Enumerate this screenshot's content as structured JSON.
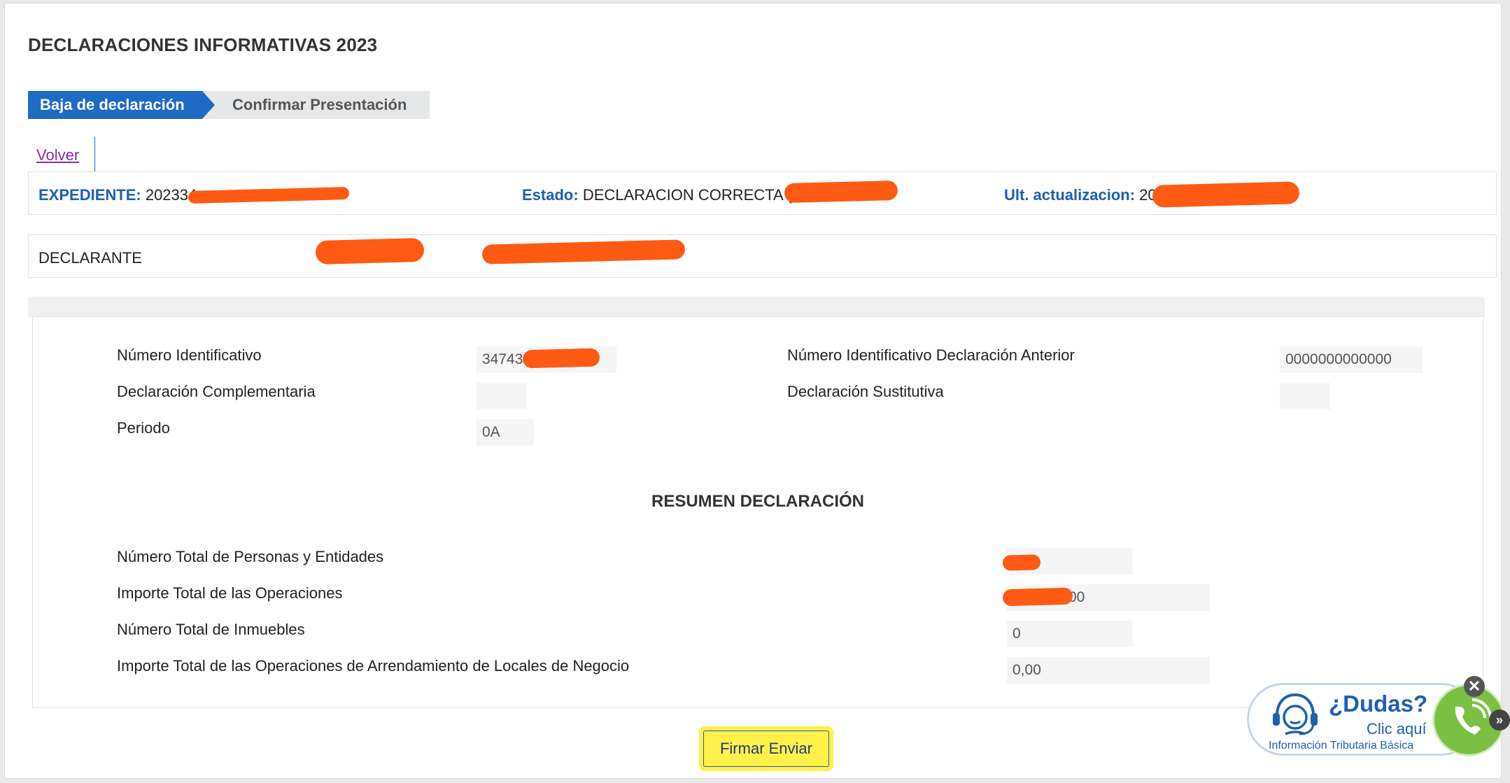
{
  "page": {
    "title": "DECLARACIONES INFORMATIVAS 2023"
  },
  "steps": [
    {
      "label": "Baja de declaración",
      "active": true
    },
    {
      "label": "Confirmar Presentación",
      "active": false
    }
  ],
  "nav": {
    "back_label": "Volver"
  },
  "expediente": {
    "expediente_label": "EXPEDIENTE:",
    "expediente_value": "202334",
    "estado_label": "Estado:",
    "estado_value": "DECLARACION CORRECTA (",
    "ult_label": "Ult. actualizacion:",
    "ult_value": "20"
  },
  "declarante": {
    "label": "DECLARANTE"
  },
  "details": {
    "numero_identificativo_label": "Número Identificativo",
    "numero_identificativo_value": "34743",
    "numero_anterior_label": "Número Identificativo Declaración Anterior",
    "numero_anterior_value": "0000000000000",
    "complementaria_label": "Declaración Complementaria",
    "complementaria_value": "",
    "sustitutiva_label": "Declaración Sustitutiva",
    "sustitutiva_value": "",
    "periodo_label": "Periodo",
    "periodo_value": "0A"
  },
  "resumen": {
    "title": "RESUMEN DECLARACIÓN",
    "personas_label": "Número Total de Personas y Entidades",
    "personas_value": "",
    "importe_label": "Importe Total de las Operaciones",
    "importe_value": "00",
    "inmuebles_label": "Número Total de Inmuebles",
    "inmuebles_value": "0",
    "arrendamiento_label": "Importe Total de las Operaciones de Arrendamiento de Locales de Negocio",
    "arrendamiento_value": "0,00"
  },
  "actions": {
    "submit_label": "Firmar Enviar"
  },
  "help": {
    "title": "¿Dudas?",
    "subtitle": "Clic aquí",
    "caption": "Información Tributaria Básica",
    "close_glyph": "✕",
    "expand_glyph": "»"
  },
  "colors": {
    "primary": "#1f6ac4",
    "link_visited": "#8d2ba5",
    "redaction": "#ff5a14",
    "highlight": "#fff14a",
    "phone_green": "#7bc043"
  }
}
